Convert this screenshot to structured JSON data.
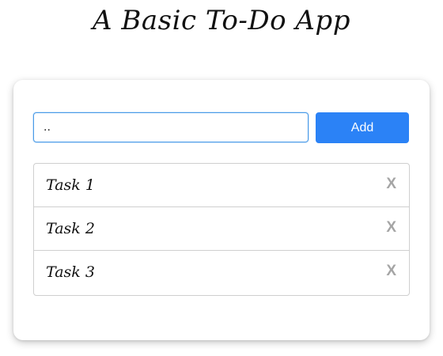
{
  "header": {
    "title": "A Basic To-Do App"
  },
  "form": {
    "input_value": "..",
    "add_label": "Add"
  },
  "tasks": [
    {
      "label": "Task 1",
      "delete_label": "X"
    },
    {
      "label": "Task 2",
      "delete_label": "X"
    },
    {
      "label": "Task 3",
      "delete_label": "X"
    }
  ],
  "colors": {
    "accent": "#2b82f6",
    "delete": "#a5a5a5",
    "border": "#cfcfcf"
  }
}
